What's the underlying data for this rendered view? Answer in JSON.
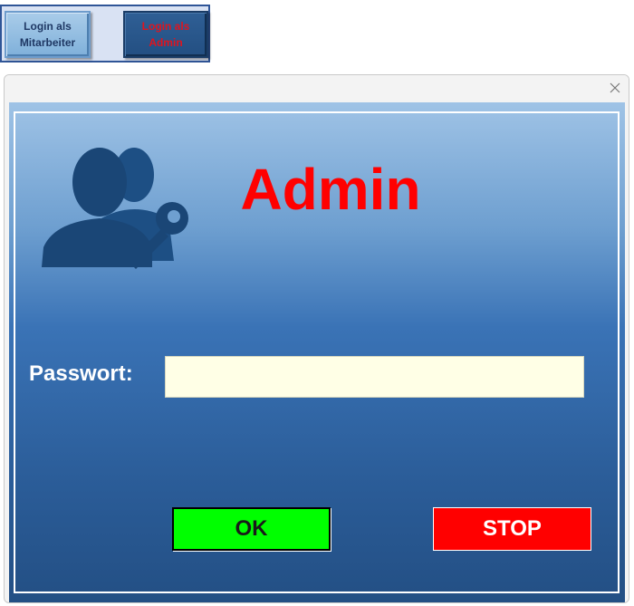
{
  "mode_buttons": {
    "employee_label": "Login als\nMitarbeiter",
    "admin_label": "Login als\nAdmin"
  },
  "dialog": {
    "close_icon": "close-icon",
    "user_icon": "user-key-icon",
    "title": "Admin",
    "password_label": "Passwort:",
    "password_value": "",
    "ok_label": "OK",
    "stop_label": "STOP"
  },
  "colors": {
    "title": "#ff0000",
    "ok_button": "#00ff00",
    "stop_button": "#ff0000",
    "panel_top": "#9fc3e6",
    "panel_bottom": "#234f84",
    "input_bg": "#ffffe6"
  }
}
